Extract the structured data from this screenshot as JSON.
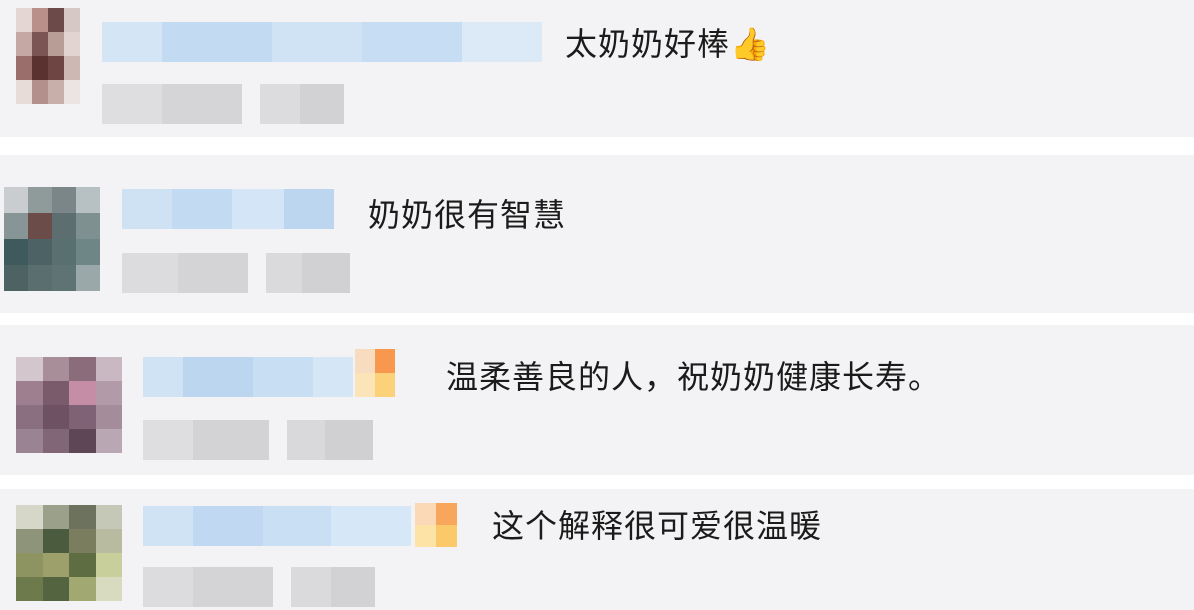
{
  "comments": [
    {
      "text": "太奶奶好棒👍"
    },
    {
      "text": "奶奶很有智慧"
    },
    {
      "text": "温柔善良的人，祝奶奶健康长寿。"
    },
    {
      "text": "这个解释很可爱很温暖"
    }
  ],
  "colors": {
    "card_background": "#f3f3f5",
    "divider": "#ffffff",
    "username_blur": "#c3dcf2",
    "meta_blur": "#dcdcde",
    "comment_text": "#1b1b1b",
    "badge_orange": "#f7a65c",
    "badge_yellow": "#fbd27a"
  }
}
